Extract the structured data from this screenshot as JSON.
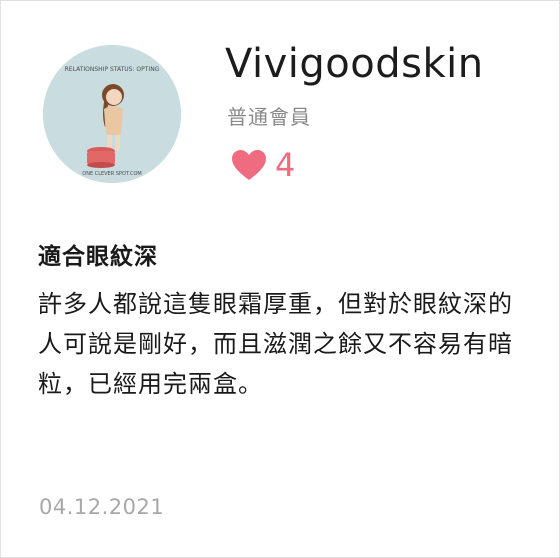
{
  "profile": {
    "avatar_caption_top": "RELATIONSHIP STATUS: OPTING",
    "avatar_caption_bottom": "ONE CLEVER SPOT.COM",
    "username": "Vivigoodskin",
    "level": "普通會員"
  },
  "likes": {
    "icon": "heart-icon",
    "count": "4",
    "color": "#ef6b7f"
  },
  "review": {
    "title": "適合眼紋深",
    "body": "許多人都說這隻眼霜厚重，但對於眼紋深的人可說是剛好，而且滋潤之餘又不容易有暗粒，已經用完兩盒。",
    "date": "04.12.2021"
  }
}
